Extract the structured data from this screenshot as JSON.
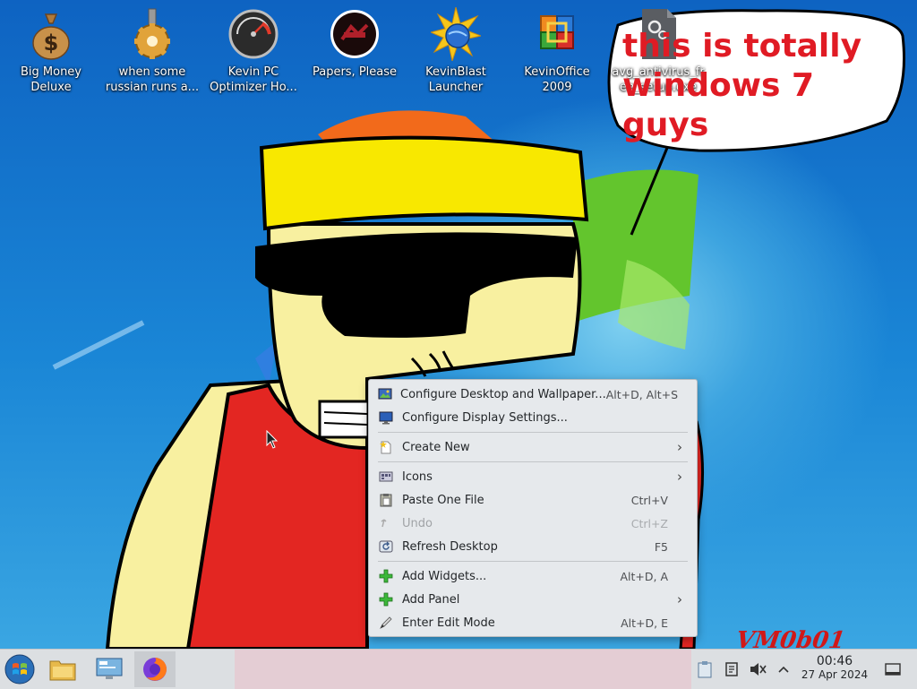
{
  "desktop": {
    "icons": [
      {
        "label": "Big Money Deluxe",
        "icon": "money-bag-icon"
      },
      {
        "label": "when some russian runs a...",
        "icon": "gear-icon"
      },
      {
        "label": "Kevin PC Optimizer Ho...",
        "icon": "gauge-icon"
      },
      {
        "label": "Papers, Please",
        "icon": "seal-icon"
      },
      {
        "label": "KevinBlast Launcher",
        "icon": "burst-globe-icon"
      },
      {
        "label": "KevinOffice 2009",
        "icon": "office-icon"
      },
      {
        "label": "avg_antivirus_free_setup.exe",
        "icon": "executable-icon"
      }
    ],
    "speech_bubble": {
      "line1": "this is totally",
      "line2": "windows 7 guys"
    },
    "watermark": "VM0b01"
  },
  "context_menu": {
    "items": [
      {
        "label": "Configure Desktop and Wallpaper...",
        "shortcut": "Alt+D, Alt+S",
        "icon": "wallpaper-icon"
      },
      {
        "label": "Configure Display Settings...",
        "shortcut": "",
        "icon": "display-icon"
      },
      {
        "label": "Create New",
        "shortcut": "",
        "icon": "new-file-icon",
        "submenu": true
      },
      {
        "label": "Icons",
        "shortcut": "",
        "icon": "icons-view-icon",
        "submenu": true
      },
      {
        "label": "Paste One File",
        "shortcut": "Ctrl+V",
        "icon": "paste-icon"
      },
      {
        "label": "Undo",
        "shortcut": "Ctrl+Z",
        "icon": "undo-icon",
        "disabled": true
      },
      {
        "label": "Refresh Desktop",
        "shortcut": "F5",
        "icon": "refresh-icon"
      },
      {
        "label": "Add Widgets...",
        "shortcut": "Alt+D, A",
        "icon": "plus-icon"
      },
      {
        "label": "Add Panel",
        "shortcut": "",
        "icon": "plus-icon",
        "submenu": true
      },
      {
        "label": "Enter Edit Mode",
        "shortcut": "Alt+D, E",
        "icon": "edit-icon"
      }
    ]
  },
  "taskbar": {
    "pinned": [
      "start-orb-icon",
      "file-manager-icon",
      "system-settings-icon",
      "firefox-icon"
    ],
    "tray": [
      "clipboard-icon",
      "notes-icon",
      "volume-muted-icon",
      "expand-tray-icon"
    ],
    "clock": {
      "time": "00:46",
      "date": "27 Apr 2024"
    }
  },
  "colors": {
    "menu_bg": "#e6e9ec",
    "taskbar_bg": "#dcdfe2",
    "bubble_text": "#e01b24"
  }
}
